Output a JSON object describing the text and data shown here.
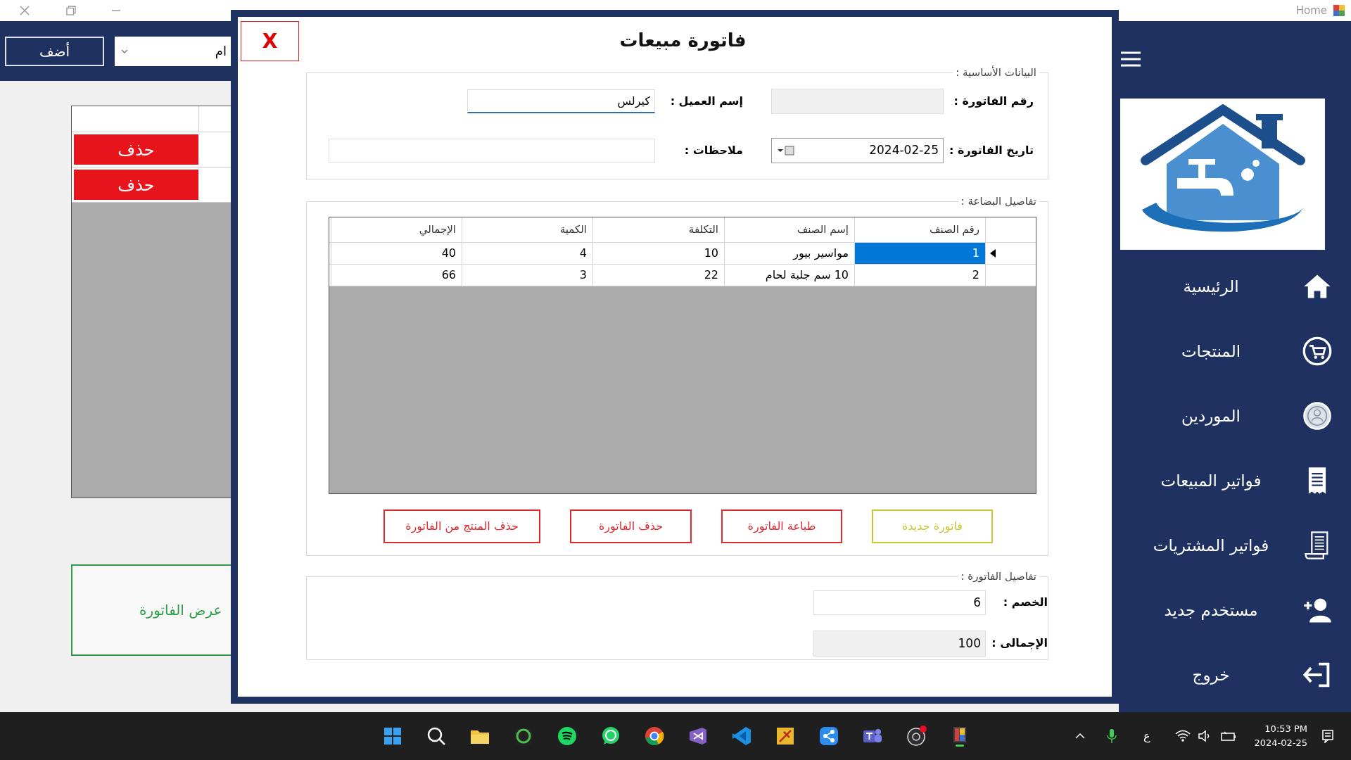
{
  "title_bar": {
    "title": "Home"
  },
  "main_form": {
    "add_button": "أضف",
    "filter_combo": {
      "value": "ام"
    },
    "grid": {
      "rows": [
        {
          "delete_button": "حذف"
        },
        {
          "delete_button": "حذف"
        }
      ]
    },
    "view_invoice_button": "عرض الفاتورة"
  },
  "dialog": {
    "close_button": "X",
    "title": "فاتورة مبيعات",
    "basic_data": {
      "legend": "البيانات الأساسية :",
      "invoice_number_label": "رقم الفاتورة :",
      "customer_name_label": "إسم العميل :",
      "customer_name_value": "كيرلس",
      "invoice_date_label": "تاريخ الفاتورة :",
      "invoice_date_value": "2024-02-25",
      "notes_label": "ملاحظات :"
    },
    "goods_details": {
      "legend": "تفاصيل البضاعة :",
      "table": {
        "columns": [
          "رقم الصنف",
          "إسم الصنف",
          "التكلفة",
          "الكمية",
          "الإجمالي"
        ],
        "rows": [
          {
            "cells": [
              "1",
              "مواسير بيور",
              "10",
              "4",
              "40"
            ],
            "selected": true
          },
          {
            "cells": [
              "2",
              "10 سم جلبة لحام",
              "22",
              "3",
              "66"
            ],
            "selected": false
          }
        ]
      },
      "buttons": [
        {
          "label": "فاتورة جديدة",
          "color": "#c8c832"
        },
        {
          "label": "طباعة الفاتورة",
          "color": "#e0282e"
        },
        {
          "label": "حذف الفاتورة",
          "color": "#e0282e"
        },
        {
          "label": "حذف المنتج من الفاتورة",
          "color": "#e0282e"
        }
      ]
    },
    "invoice_details": {
      "legend": "تفاصيل الفاتورة :",
      "discount_label": "الخصم :",
      "discount_value": "6",
      "total_label": "الإجمالى :",
      "total_value": "100"
    }
  },
  "sidebar": {
    "items": [
      "الرئيسية",
      "المنتجات",
      "الموردين",
      "فواتير المبيعات",
      "فواتير المشتريات",
      "مستخدم جديد",
      "خروج"
    ]
  },
  "taskbar": {
    "language": "ع",
    "time": "10:53 PM",
    "date": "2024-02-25"
  }
}
